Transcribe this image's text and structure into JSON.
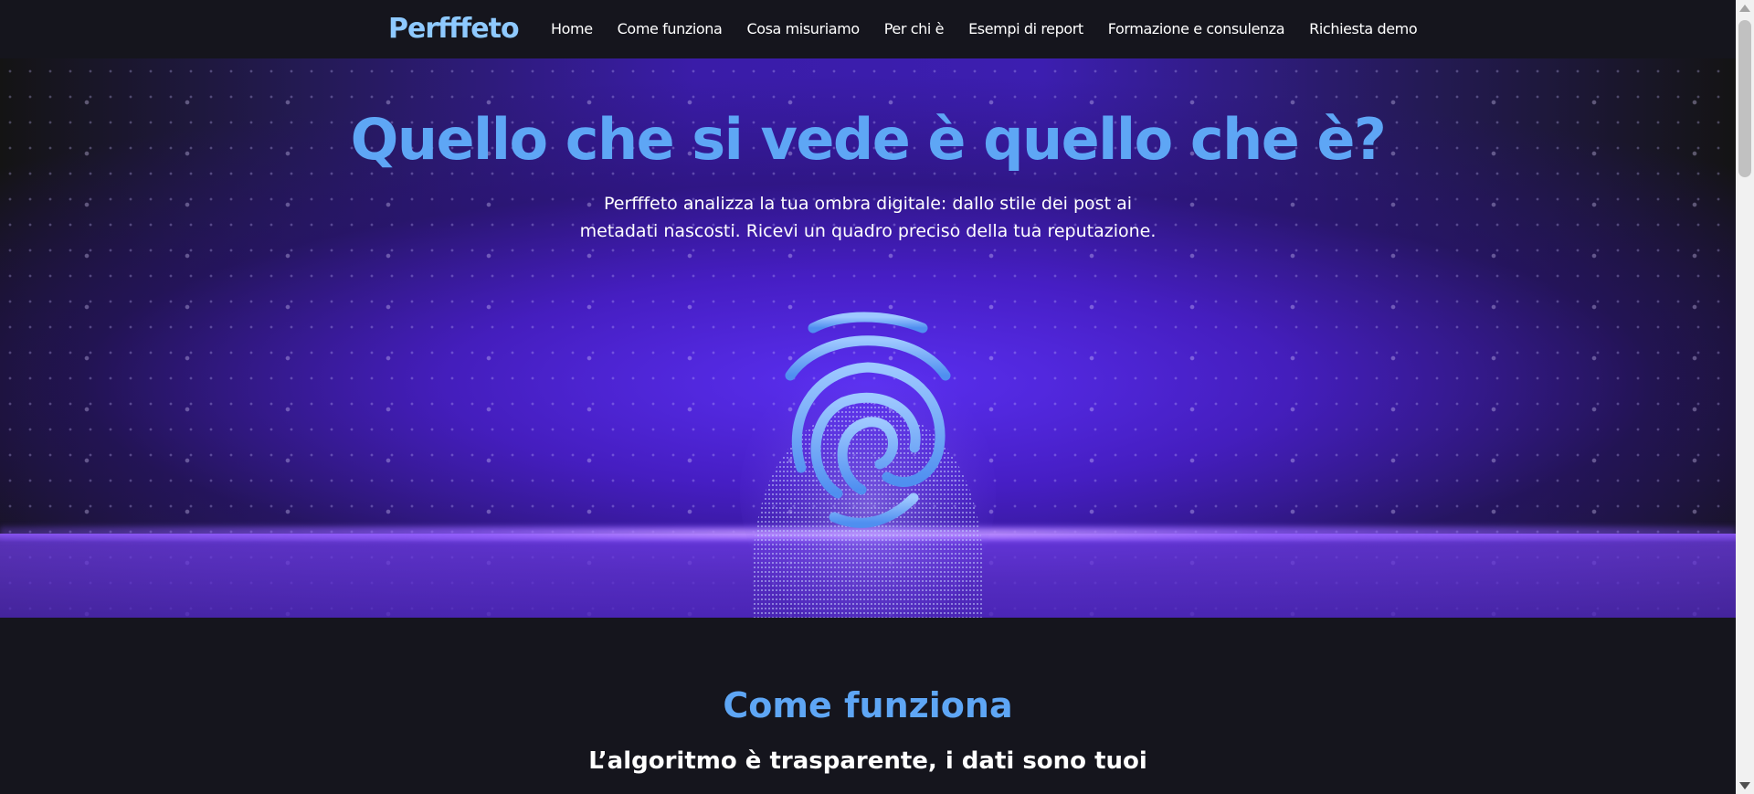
{
  "nav": {
    "logo": "Perfffeto",
    "links": [
      "Home",
      "Come funziona",
      "Cosa misuriamo",
      "Per chi è",
      "Esempi di report",
      "Formazione e consulenza",
      "Richiesta demo"
    ]
  },
  "hero": {
    "title": "Quello che si vede è quello che è?",
    "subtitle": "Perfffeto analizza la tua ombra digitale: dallo stile dei post ai metadati nascosti. Ricevi un quadro preciso della tua reputazione.",
    "image_icon": "fingerprint-icon"
  },
  "section": {
    "title": "Come funziona",
    "subtitle": "L’algoritmo è trasparente, i dati sono tuoi"
  },
  "colors": {
    "accent": "#5ea6f5",
    "logo": "#8ec9ff",
    "background": "#15151d",
    "hero_glow": "#5a2ff0"
  }
}
